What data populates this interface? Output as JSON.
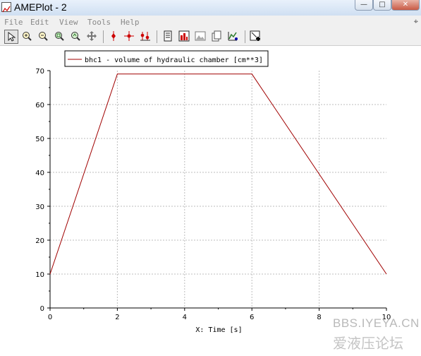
{
  "window": {
    "title": "AMEPlot - 2"
  },
  "window_controls": {
    "minimize": "—",
    "maximize": "□",
    "close": "✕"
  },
  "menu": {
    "items": [
      "File",
      "Edit",
      "View",
      "Tools",
      "Help"
    ],
    "pin_icon": "pin-icon"
  },
  "toolbar": {
    "groups": [
      [
        "select-tool-icon",
        "zoom-in-icon",
        "zoom-out-icon",
        "zoom-fit-icon",
        "zoom-box-icon",
        "pan-icon"
      ],
      [
        "marker-red-icon",
        "crosshair-icon",
        "multi-marker-icon"
      ],
      [
        "document-icon",
        "bar-chart-icon",
        "image-icon",
        "copy-icon",
        "curve-icon"
      ],
      [
        "export-icon"
      ]
    ]
  },
  "chart_data": {
    "type": "line",
    "title": "",
    "xlabel": "X: Time [s]",
    "ylabel": "",
    "xlim": [
      0,
      10
    ],
    "ylim": [
      0,
      70
    ],
    "xticks": [
      0,
      2,
      4,
      6,
      8,
      10
    ],
    "yticks": [
      0,
      10,
      20,
      30,
      40,
      50,
      60,
      70
    ],
    "grid": true,
    "legend_position": "top-left",
    "series": [
      {
        "name": "bhc1 - volume of hydraulic chamber [cm**3]",
        "color": "#a00000",
        "x": [
          0,
          2,
          6,
          10
        ],
        "y": [
          10,
          69,
          69,
          10
        ]
      }
    ]
  },
  "watermark": {
    "line1": "BBS.IYEYA.CN",
    "line2": "爱液压论坛"
  }
}
